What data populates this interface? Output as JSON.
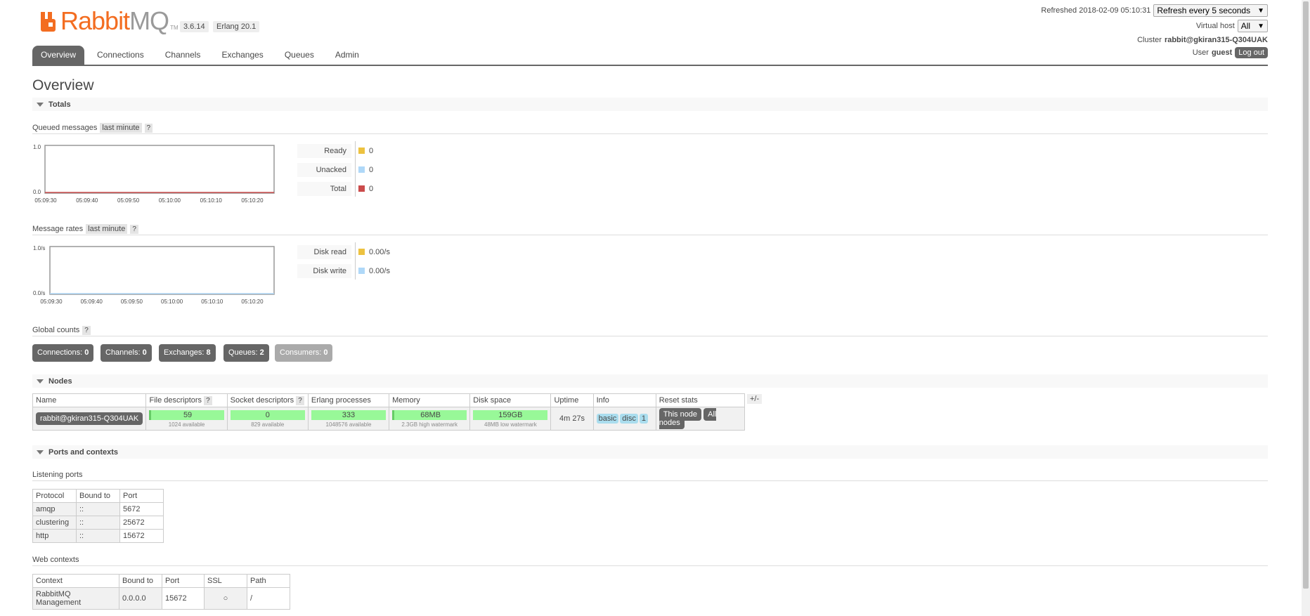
{
  "header": {
    "logo_rabbit": "Rabbit",
    "logo_mq": "MQ",
    "logo_tm": "TM",
    "version": "3.6.14",
    "erlang": "Erlang 20.1",
    "refreshed": "Refreshed 2018-02-09 05:10:31",
    "refresh_select": "Refresh every 5 seconds",
    "virtual_host_label": "Virtual host",
    "virtual_host_value": "All",
    "cluster_label": "Cluster",
    "cluster_value": "rabbit@gkiran315-Q304UAK",
    "user_label": "User",
    "user_value": "guest",
    "logout": "Log out"
  },
  "tabs": [
    "Overview",
    "Connections",
    "Channels",
    "Exchanges",
    "Queues",
    "Admin"
  ],
  "page_title": "Overview",
  "totals": {
    "title": "Totals",
    "queued": {
      "label": "Queued messages",
      "period": "last minute",
      "help": "?",
      "ytop": "1.0",
      "ybottom": "0.0",
      "xticks": [
        "05:09:30",
        "05:09:40",
        "05:09:50",
        "05:10:00",
        "05:10:10",
        "05:10:20"
      ],
      "legend": [
        {
          "label": "Ready",
          "value": "0",
          "color": "#edc240"
        },
        {
          "label": "Unacked",
          "value": "0",
          "color": "#afd8f8"
        },
        {
          "label": "Total",
          "value": "0",
          "color": "#cb4b4b"
        }
      ]
    },
    "rates": {
      "label": "Message rates",
      "period": "last minute",
      "help": "?",
      "ytop": "1.0/s",
      "ybottom": "0.0/s",
      "xticks": [
        "05:09:30",
        "05:09:40",
        "05:09:50",
        "05:10:00",
        "05:10:10",
        "05:10:20"
      ],
      "legend": [
        {
          "label": "Disk read",
          "value": "0.00/s",
          "color": "#edc240"
        },
        {
          "label": "Disk write",
          "value": "0.00/s",
          "color": "#afd8f8"
        }
      ]
    },
    "global_counts": {
      "label": "Global counts",
      "help": "?",
      "items": [
        {
          "label": "Connections:",
          "value": "0"
        },
        {
          "label": "Channels:",
          "value": "0"
        },
        {
          "label": "Exchanges:",
          "value": "8"
        },
        {
          "label": "Queues:",
          "value": "2"
        },
        {
          "label": "Consumers:",
          "value": "0"
        }
      ]
    }
  },
  "nodes": {
    "title": "Nodes",
    "plusminus": "+/-",
    "columns": [
      "Name",
      "File descriptors",
      "Socket descriptors",
      "Erlang processes",
      "Memory",
      "Disk space",
      "Uptime",
      "Info",
      "Reset stats"
    ],
    "help": "?",
    "row": {
      "name": "rabbit@gkiran315-Q304UAK",
      "fd": "59",
      "fd_sub": "1024 available",
      "sock": "0",
      "sock_sub": "829 available",
      "proc": "333",
      "proc_sub": "1048576 available",
      "mem": "68MB",
      "mem_sub": "2.3GB high watermark",
      "disk": "159GB",
      "disk_sub": "48MB low watermark",
      "uptime": "4m 27s",
      "info": [
        "basic",
        "disc",
        "1"
      ],
      "this_node": "This node",
      "all_nodes": "All nodes"
    }
  },
  "ports": {
    "title": "Ports and contexts",
    "listening_label": "Listening ports",
    "listening_cols": [
      "Protocol",
      "Bound to",
      "Port"
    ],
    "listening_rows": [
      [
        "amqp",
        "::",
        "5672"
      ],
      [
        "clustering",
        "::",
        "25672"
      ],
      [
        "http",
        "::",
        "15672"
      ]
    ],
    "web_label": "Web contexts",
    "web_cols": [
      "Context",
      "Bound to",
      "Port",
      "SSL",
      "Path"
    ],
    "web_rows": [
      [
        "RabbitMQ Management",
        "0.0.0.0",
        "15672",
        "○",
        "/"
      ]
    ]
  }
}
